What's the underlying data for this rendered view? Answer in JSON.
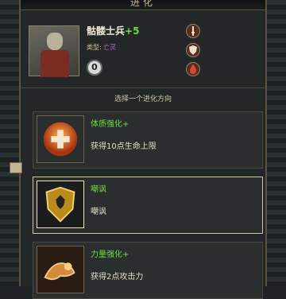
{
  "header": {
    "title": "进化"
  },
  "unit": {
    "name": "骷髅士兵",
    "level_plus": "+5",
    "type_label": "类型:",
    "type_value": "亡灵",
    "level_value": "0"
  },
  "stats_icons": [
    "sword-icon",
    "shield-icon",
    "blood-drop-icon"
  ],
  "section": {
    "title": "选择一个进化方向"
  },
  "options": [
    {
      "title": "体质强化+",
      "desc": "获得10点生命上限",
      "icon": "health-cross-icon"
    },
    {
      "title": "嘲讽",
      "desc": "嘲讽",
      "icon": "taunt-shield-icon"
    },
    {
      "title": "力量强化+",
      "desc": "获得2点攻击力",
      "icon": "strength-arm-icon"
    }
  ],
  "colors": {
    "accent_green": "#6ddf3a",
    "type_purple": "#c45ad4",
    "frame_gold": "#5b5242"
  }
}
